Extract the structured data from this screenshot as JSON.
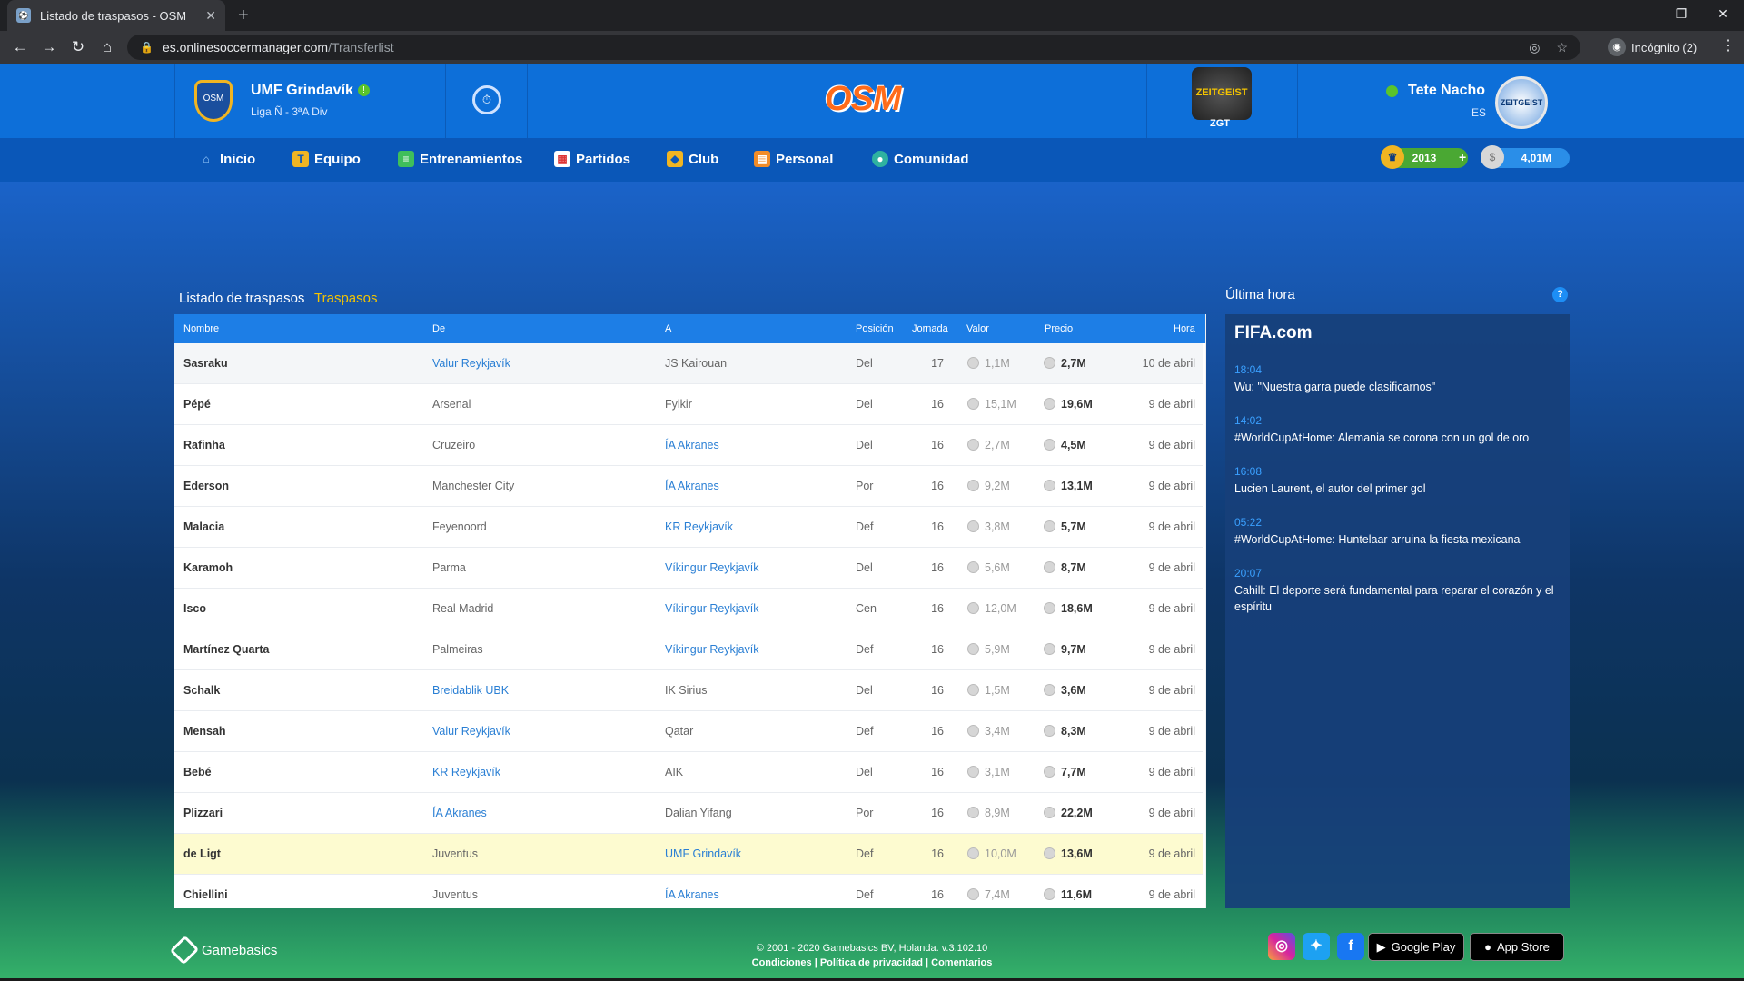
{
  "browser": {
    "tab_title": "Listado de traspasos - OSM",
    "url_host": "es.onlinesoccermanager.com",
    "url_path": "/Transferlist",
    "incognito_label": "Incógnito (2)"
  },
  "header": {
    "club_name": "UMF Grindavík",
    "club_league": "Liga Ñ - 3ªA Div",
    "club_badge_text": "OSM",
    "logo_text": "OSM",
    "zgt_badge_text": "ZEITGEIST",
    "zgt_label": "ZGT",
    "user_name": "Tete Nacho",
    "user_country": "ES",
    "user_avatar_text": "ZEITGEIST"
  },
  "nav": {
    "items": [
      "Inicio",
      "Equipo",
      "Entrenamientos",
      "Partidos",
      "Club",
      "Personal",
      "Comunidad"
    ],
    "boss_coins": "2013",
    "plus": "+",
    "money": "4,01M"
  },
  "transfers": {
    "title": "Listado de traspasos",
    "subtitle": "Traspasos",
    "columns": [
      "Nombre",
      "De",
      "A",
      "Posición",
      "Jornada",
      "Valor",
      "Precio",
      "Hora"
    ],
    "rows": [
      {
        "name": "Sasraku",
        "from": "Valur Reykjavík",
        "to": "JS Kairouan",
        "pos": "Del",
        "round": "17",
        "value": "1,1M",
        "price": "2,7M",
        "time": "10 de abril"
      },
      {
        "name": "Pépé",
        "from": "Arsenal",
        "to": "Fylkir",
        "pos": "Del",
        "round": "16",
        "value": "15,1M",
        "price": "19,6M",
        "time": "9 de abril"
      },
      {
        "name": "Rafinha",
        "from": "Cruzeiro",
        "to": "ÍA Akranes",
        "pos": "Del",
        "round": "16",
        "value": "2,7M",
        "price": "4,5M",
        "time": "9 de abril"
      },
      {
        "name": "Ederson",
        "from": "Manchester City",
        "to": "ÍA Akranes",
        "pos": "Por",
        "round": "16",
        "value": "9,2M",
        "price": "13,1M",
        "time": "9 de abril"
      },
      {
        "name": "Malacia",
        "from": "Feyenoord",
        "to": "KR Reykjavík",
        "pos": "Def",
        "round": "16",
        "value": "3,8M",
        "price": "5,7M",
        "time": "9 de abril"
      },
      {
        "name": "Karamoh",
        "from": "Parma",
        "to": "Víkingur Reykjavík",
        "pos": "Del",
        "round": "16",
        "value": "5,6M",
        "price": "8,7M",
        "time": "9 de abril"
      },
      {
        "name": "Isco",
        "from": "Real Madrid",
        "to": "Víkingur Reykjavík",
        "pos": "Cen",
        "round": "16",
        "value": "12,0M",
        "price": "18,6M",
        "time": "9 de abril"
      },
      {
        "name": "Martínez Quarta",
        "from": "Palmeiras",
        "to": "Víkingur Reykjavík",
        "pos": "Def",
        "round": "16",
        "value": "5,9M",
        "price": "9,7M",
        "time": "9 de abril"
      },
      {
        "name": "Schalk",
        "from": "Breidablik UBK",
        "to": "IK Sirius",
        "pos": "Del",
        "round": "16",
        "value": "1,5M",
        "price": "3,6M",
        "time": "9 de abril"
      },
      {
        "name": "Mensah",
        "from": "Valur Reykjavík",
        "to": "Qatar",
        "pos": "Def",
        "round": "16",
        "value": "3,4M",
        "price": "8,3M",
        "time": "9 de abril"
      },
      {
        "name": "Bebé",
        "from": "KR Reykjavík",
        "to": "AIK",
        "pos": "Del",
        "round": "16",
        "value": "3,1M",
        "price": "7,7M",
        "time": "9 de abril"
      },
      {
        "name": "Plizzari",
        "from": "ÍA Akranes",
        "to": "Dalian Yifang",
        "pos": "Por",
        "round": "16",
        "value": "8,9M",
        "price": "22,2M",
        "time": "9 de abril"
      },
      {
        "name": "de Ligt",
        "from": "Juventus",
        "to": "UMF Grindavík",
        "pos": "Def",
        "round": "16",
        "value": "10,0M",
        "price": "13,6M",
        "time": "9 de abril"
      },
      {
        "name": "Chiellini",
        "from": "Juventus",
        "to": "ÍA Akranes",
        "pos": "Def",
        "round": "16",
        "value": "7,4M",
        "price": "11,6M",
        "time": "9 de abril"
      }
    ]
  },
  "news": {
    "title": "Última hora",
    "help": "?",
    "source": "FIFA.com",
    "items": [
      {
        "time": "18:04",
        "text": "Wu: \"Nuestra garra puede clasificarnos\""
      },
      {
        "time": "14:02",
        "text": "#WorldCupAtHome: Alemania se corona con un gol de oro"
      },
      {
        "time": "16:08",
        "text": "Lucien Laurent, el autor del primer gol"
      },
      {
        "time": "05:22",
        "text": "#WorldCupAtHome: Huntelaar arruina la fiesta mexicana"
      },
      {
        "time": "20:07",
        "text": "Cahill: El deporte será fundamental para reparar el corazón y el espíritu"
      }
    ]
  },
  "footer": {
    "brand": "Gamebasics",
    "copyright": "© 2001 - 2020 Gamebasics BV, Holanda. v.3.102.10",
    "links": "Condiciones | Política de privacidad | Comentarios",
    "google_play": "Google Play",
    "app_store": "App Store"
  }
}
